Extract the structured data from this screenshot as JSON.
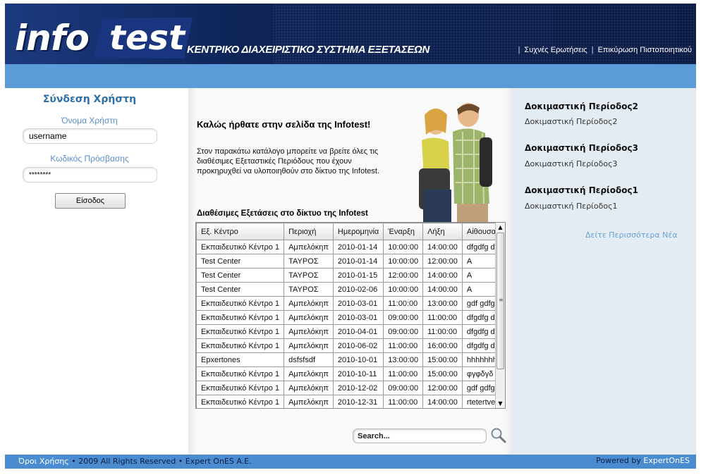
{
  "header": {
    "logo_part1": "info",
    "logo_part2": "test",
    "slogan": "ΚΕΝΤΡΙΚΟ ΔΙΑΧΕΙΡΙΣΤΙΚΟ ΣΥΣΤΗΜΑ ΕΞΕΤΑΣΕΩΝ",
    "links": [
      "Συχνές Ερωτήσεις",
      "Επικύρωση Πιστοποιητικού"
    ]
  },
  "login": {
    "title": "Σύνδεση Χρήστη",
    "username_label": "Όνομα Χρήστη",
    "username_value": "username",
    "password_label": "Κωδικός Πρόσβασης",
    "password_value": "********",
    "submit_label": "Είσοδος"
  },
  "main": {
    "welcome": "Καλώς ήρθατε στην σελίδα της Infotest!",
    "intro": "Στον παρακάτω κατάλογο μπορείτε να βρείτε όλες τις διαθέσιμες Εξεταστικές Περιόδους που έχουν προκηρυχθεί να υλοποιηθούν στο δίκτυο της Infotest.",
    "table_title": "Διαθέσιμες Εξετάσεις στο δίκτυο της Infotest",
    "columns": [
      "Εξ. Κέντρο",
      "Περιοχή",
      "Ημερομηνία",
      "Έναρξη",
      "Λήξη",
      "Αίθουσα"
    ],
    "rows": [
      [
        "Εκπαιδευτικό Κέντρο 1",
        "Αμπελόκηπ",
        "2010-01-14",
        "10:00:00",
        "14:00:00",
        "dfgdfg df"
      ],
      [
        "Test Center",
        "ΤΑΥΡΟΣ",
        "2010-01-14",
        "10:00:00",
        "12:00:00",
        "A"
      ],
      [
        "Test Center",
        "ΤΑΥΡΟΣ",
        "2010-01-15",
        "12:00:00",
        "14:00:00",
        "A"
      ],
      [
        "Test Center",
        "ΤΑΥΡΟΣ",
        "2010-02-06",
        "10:00:00",
        "14:00:00",
        "A"
      ],
      [
        "Εκπαιδευτικό Κέντρο 1",
        "Αμπελόκηπ",
        "2010-03-01",
        "11:00:00",
        "13:00:00",
        "gdf gdfg"
      ],
      [
        "Εκπαιδευτικό Κέντρο 1",
        "Αμπελόκηπ",
        "2010-03-01",
        "09:00:00",
        "11:00:00",
        "dfgdfg df"
      ],
      [
        "Εκπαιδευτικό Κέντρο 1",
        "Αμπελόκηπ",
        "2010-04-01",
        "09:00:00",
        "11:00:00",
        "dfgdfg df"
      ],
      [
        "Εκπαιδευτικό Κέντρο 1",
        "Αμπελόκηπ",
        "2010-06-02",
        "11:00:00",
        "16:00:00",
        "dfgdfg df"
      ],
      [
        "Epxertones",
        "dsfsfsdf",
        "2010-10-01",
        "13:00:00",
        "15:00:00",
        "hhhhhhhl"
      ],
      [
        "Εκπαιδευτικό Κέντρο 1",
        "Αμπελόκηπ",
        "2010-10-11",
        "11:00:00",
        "15:00:00",
        "φγφδγδ ς"
      ],
      [
        "Εκπαιδευτικό Κέντρο 1",
        "Αμπελόκηπ",
        "2010-12-02",
        "09:00:00",
        "12:00:00",
        "gdf gdfg"
      ],
      [
        "Εκπαιδευτικό Κέντρο 1",
        "Αμπελόκηπ",
        "2010-12-31",
        "11:00:00",
        "14:00:00",
        "rtetertver"
      ]
    ],
    "search_placeholder": "Search..."
  },
  "news": {
    "items": [
      {
        "title": "Δοκιμαστική Περίοδος2",
        "subtitle": "Δοκιμαστική Περίοδος2"
      },
      {
        "title": "Δοκιμαστική Περίοδος3",
        "subtitle": "Δοκιμαστική Περίοδος3"
      },
      {
        "title": "Δοκιμαστική Περίοδος1",
        "subtitle": "Δοκιμαστική Περίοδος1"
      }
    ],
    "more_label": "Δείτε Περισσότερα Νέα"
  },
  "footer": {
    "terms": "Όροι Χρήσης",
    "rights": "• 2009 All Rights Reserved • Expert OnES A.E.",
    "powered_by": "Powered by",
    "brand": "ExpertOnES"
  },
  "colors": {
    "header_dark": "#0e2456",
    "accent_blue": "#5a9bd8",
    "footer_blue": "#4b8bd0",
    "login_title": "#2e6faa"
  }
}
